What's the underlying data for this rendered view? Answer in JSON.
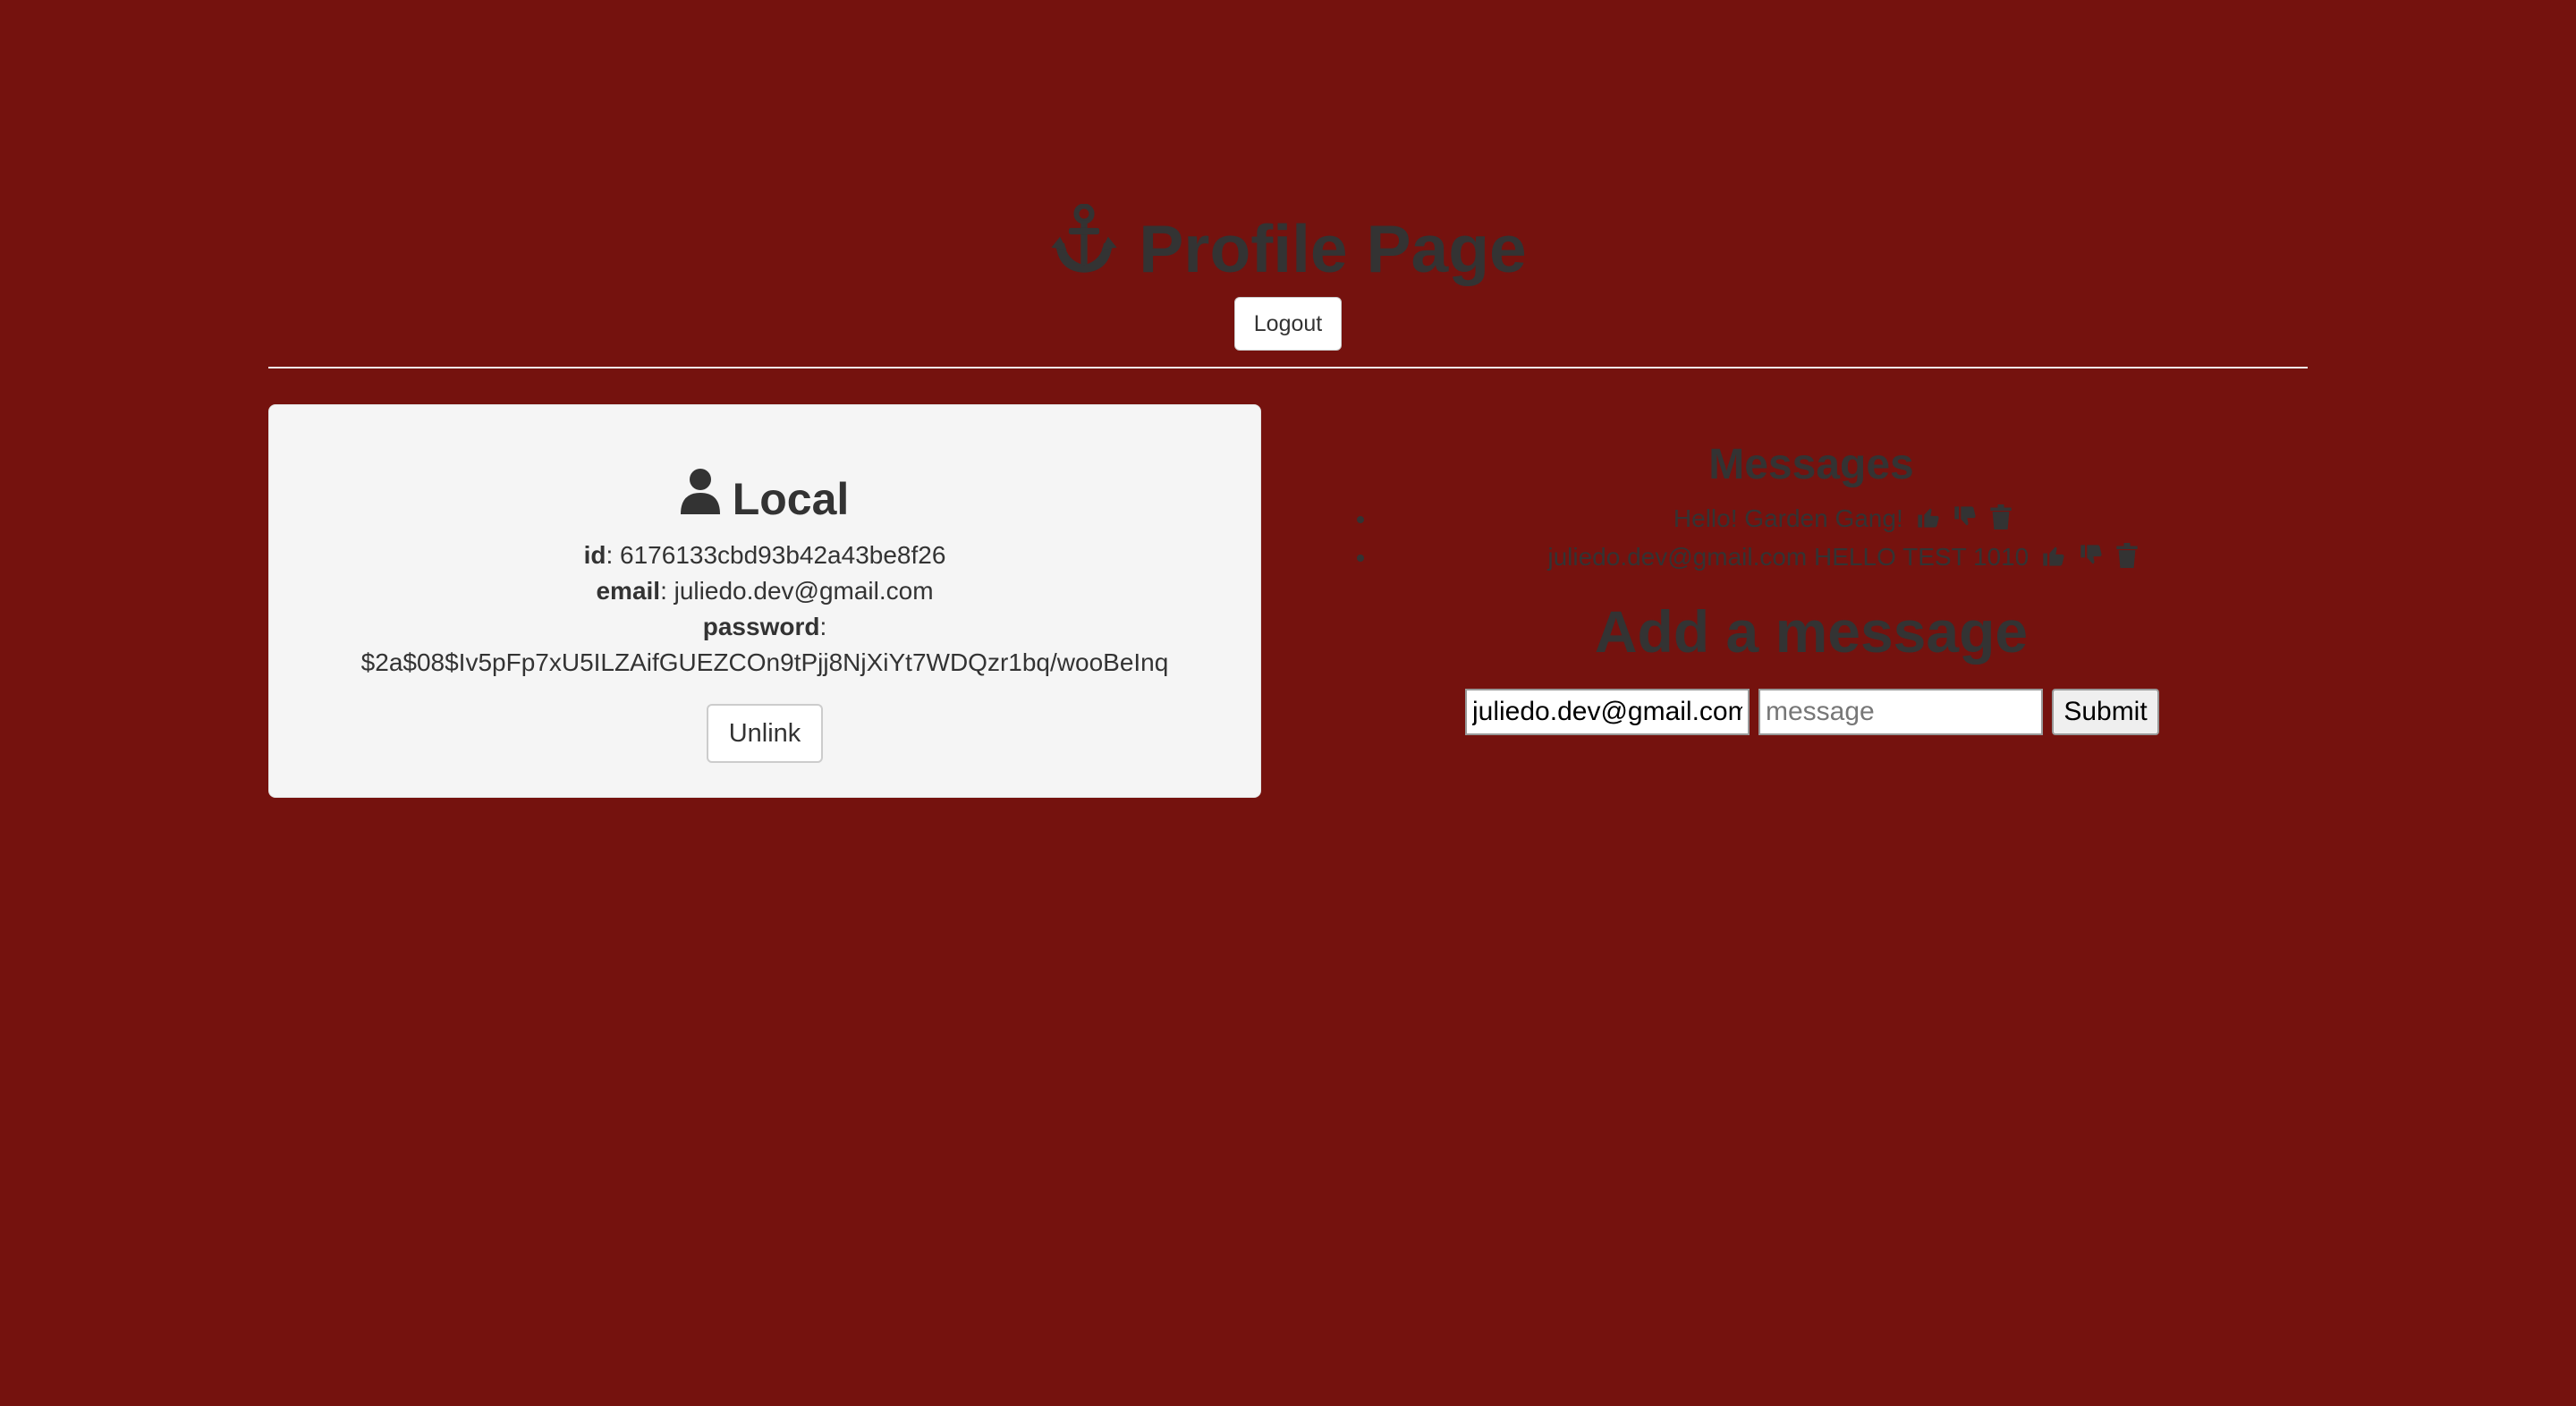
{
  "header": {
    "title": "Profile Page",
    "title_icon": "anchor-icon",
    "logout_label": "Logout"
  },
  "local_card": {
    "title": "Local",
    "title_icon": "user-icon",
    "id_label": "id",
    "id_value": "6176133cbd93b42a43be8f26",
    "email_label": "email",
    "email_value": "juliedo.dev@gmail.com",
    "password_label": "password",
    "password_value": "$2a$08$Iv5pFp7xU5ILZAifGUEZCOn9tPjj8NjXiYt7WDQzr1bq/wooBeInq",
    "unlink_label": "Unlink"
  },
  "messages": {
    "title": "Messages",
    "items": [
      {
        "text": "Hello! Garden Gang!",
        "icons": [
          "thumbs-up-icon",
          "thumbs-down-icon",
          "trash-icon"
        ]
      },
      {
        "text": "juliedo.dev@gmail.com HELLO TEST 1010",
        "icons": [
          "thumbs-up-icon",
          "thumbs-down-icon",
          "trash-icon"
        ]
      }
    ]
  },
  "add_message": {
    "title": "Add a message",
    "name_value": "juliedo.dev@gmail.com",
    "message_placeholder": "message",
    "submit_label": "Submit"
  },
  "colors": {
    "background": "#75120e",
    "text": "#333333",
    "card_background": "#f5f5f5"
  }
}
